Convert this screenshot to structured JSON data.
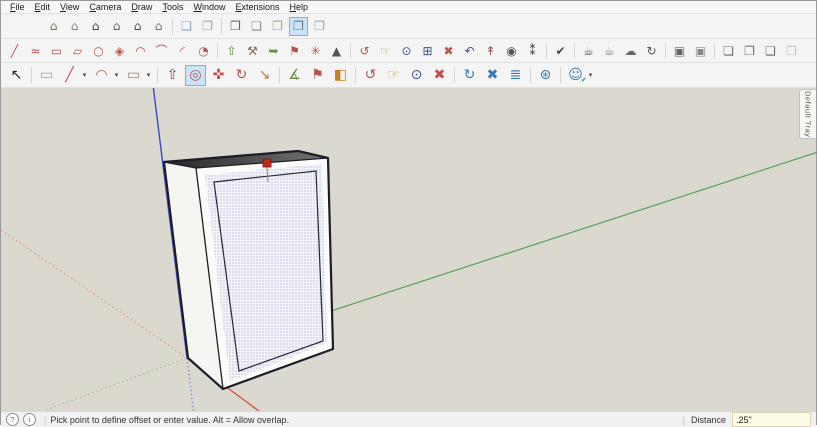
{
  "menu_bar": {
    "items": [
      "File",
      "Edit",
      "View",
      "Camera",
      "Draw",
      "Tools",
      "Window",
      "Extensions",
      "Help"
    ]
  },
  "toolbars": {
    "rows": [
      {
        "name": "toolbar-row1",
        "items": [
          {
            "name": "view-iso",
            "glyph": "⌂",
            "color": "#7d6a50"
          },
          {
            "name": "view-top",
            "glyph": "⌂",
            "color": "#8b7f6b"
          },
          {
            "name": "view-front",
            "glyph": "⌂",
            "color": "#3f3f3f"
          },
          {
            "name": "view-right",
            "glyph": "⌂",
            "color": "#6b5b49"
          },
          {
            "name": "view-back",
            "glyph": "⌂",
            "color": "#4a4a4a"
          },
          {
            "name": "view-left",
            "glyph": "⌂",
            "color": "#6e6e6e"
          },
          {
            "type": "separator"
          },
          {
            "name": "face-style-xray",
            "glyph": "❏",
            "color": "#7fa6c9"
          },
          {
            "name": "face-style-back-edges",
            "glyph": "❐",
            "color": "#9aa0a8"
          },
          {
            "type": "separator"
          },
          {
            "name": "face-style-wireframe",
            "glyph": "❒",
            "color": "#5b5b6b"
          },
          {
            "name": "face-style-hidden-line",
            "glyph": "❏",
            "color": "#8a8a8a"
          },
          {
            "name": "face-style-shaded",
            "glyph": "❐",
            "color": "#b09a72"
          },
          {
            "name": "face-style-shaded-textures",
            "glyph": "❒",
            "color": "#5a748f",
            "selected": true
          },
          {
            "name": "face-style-monochrome",
            "glyph": "❐",
            "color": "#8fa3b5"
          }
        ]
      },
      {
        "name": "toolbar-row2",
        "items": [
          {
            "name": "line-sketchy",
            "glyph": "╱",
            "color": "#b5534e"
          },
          {
            "name": "freehand-sketchy",
            "glyph": "≈",
            "color": "#b5534e"
          },
          {
            "name": "rectangle-sketchy",
            "glyph": "▭",
            "color": "#b5534e"
          },
          {
            "name": "rotated-rectangle-sketchy",
            "glyph": "▱",
            "color": "#b5534e"
          },
          {
            "name": "circle-sketchy",
            "glyph": "○",
            "color": "#b5534e"
          },
          {
            "name": "polygon-sketchy",
            "glyph": "◈",
            "color": "#b5534e"
          },
          {
            "name": "arc-sketchy",
            "glyph": "◠",
            "color": "#b5534e"
          },
          {
            "name": "two-point-arc-sketchy",
            "glyph": "⌒",
            "color": "#b5534e"
          },
          {
            "name": "three-point-arc-sketchy",
            "glyph": "◜",
            "color": "#b5534e"
          },
          {
            "name": "pie-sketchy",
            "glyph": "◔",
            "color": "#b5534e"
          },
          {
            "type": "separator"
          },
          {
            "name": "push-pull-sketchy",
            "glyph": "⇧",
            "color": "#6a8a3a"
          },
          {
            "name": "follow-me-sketchy",
            "glyph": "⚒",
            "color": "#7a6a5a"
          },
          {
            "name": "offset-sketchy",
            "glyph": "➥",
            "color": "#6a8a3a"
          },
          {
            "name": "text-sketchy",
            "glyph": "⚑",
            "color": "#b0524d"
          },
          {
            "name": "axes-tool",
            "glyph": "✳",
            "color": "#c0504d"
          },
          {
            "name": "cone-tool",
            "glyph": "▲",
            "color": "#555555"
          },
          {
            "type": "separator"
          },
          {
            "name": "orbit-small",
            "glyph": "↺",
            "color": "#b5534e"
          },
          {
            "name": "pan-small",
            "glyph": "☞",
            "color": "#c8a05a"
          },
          {
            "name": "zoom-small",
            "glyph": "⊙",
            "color": "#44508a"
          },
          {
            "name": "zoom-window",
            "glyph": "⊞",
            "color": "#44508a"
          },
          {
            "name": "zoom-extents-small",
            "glyph": "✖",
            "color": "#c0504d"
          },
          {
            "name": "zoom-previous",
            "glyph": "↶",
            "color": "#44508a"
          },
          {
            "name": "position-camera",
            "glyph": "↟",
            "color": "#8a5a5a"
          },
          {
            "name": "look-around",
            "glyph": "◉",
            "color": "#555555"
          },
          {
            "name": "walk",
            "glyph": "⁑",
            "color": "#333333"
          },
          {
            "type": "separator"
          },
          {
            "name": "model-checker",
            "glyph": "✔",
            "color": "#444444"
          },
          {
            "type": "separator"
          },
          {
            "name": "get-models-teapot",
            "glyph": "☕",
            "color": "#555555"
          },
          {
            "name": "share-model-teapot",
            "glyph": "☕",
            "color": "#888888"
          },
          {
            "name": "share-component-cloud",
            "glyph": "☁",
            "color": "#666666"
          },
          {
            "name": "trimble-connect-sync",
            "glyph": "↻",
            "color": "#555555"
          },
          {
            "type": "separator"
          },
          {
            "name": "match-photo",
            "glyph": "▣",
            "color": "#666666"
          },
          {
            "name": "photo-textures",
            "glyph": "▣",
            "color": "#8a8a8a"
          },
          {
            "type": "separator"
          },
          {
            "name": "styles-dialog",
            "glyph": "❏",
            "color": "#6a6a6a"
          },
          {
            "name": "scenes-dialog",
            "glyph": "❐",
            "color": "#6a6a6a"
          },
          {
            "name": "shadows-dialog",
            "glyph": "❑",
            "color": "#6a6a6a"
          },
          {
            "name": "watermark-dialog",
            "glyph": "❒",
            "color": "#6a6a6a",
            "disabled": true
          }
        ]
      },
      {
        "name": "toolbar-row3",
        "items": [
          {
            "name": "select-tool",
            "glyph": "↖",
            "color": "#1a1a1a"
          },
          {
            "type": "separator"
          },
          {
            "name": "eraser-tool",
            "glyph": "▭",
            "color": "#d08a96"
          },
          {
            "name": "line-tool",
            "glyph": "╱",
            "color": "#b5534e",
            "dropdown": true
          },
          {
            "name": "arc-tool",
            "glyph": "◠",
            "color": "#b5534e",
            "dropdown": true
          },
          {
            "name": "rectangle-tool",
            "glyph": "▭",
            "color": "#9a8a6a",
            "dropdown": true
          },
          {
            "type": "separator"
          },
          {
            "name": "push-pull-tool",
            "glyph": "⇧",
            "color": "#8a4a3a"
          },
          {
            "name": "offset-tool",
            "glyph": "◎",
            "color": "#c0504d",
            "selected": true
          },
          {
            "name": "move-tool",
            "glyph": "✜",
            "color": "#c0504d"
          },
          {
            "name": "rotate-tool",
            "glyph": "↻",
            "color": "#c0504d"
          },
          {
            "name": "scale-tool",
            "glyph": "↘",
            "color": "#b07a4a"
          },
          {
            "type": "separator"
          },
          {
            "name": "tape-measure-tool",
            "glyph": "∡",
            "color": "#6a8a4a"
          },
          {
            "name": "text-tool",
            "glyph": "⚑",
            "color": "#b5534e"
          },
          {
            "name": "paint-bucket-tool",
            "glyph": "◧",
            "color": "#c87d2a"
          },
          {
            "type": "separator"
          },
          {
            "name": "orbit-tool",
            "glyph": "↺",
            "color": "#b5534e"
          },
          {
            "name": "pan-tool",
            "glyph": "☞",
            "color": "#c8a05a"
          },
          {
            "name": "zoom-tool",
            "glyph": "⊙",
            "color": "#44508a"
          },
          {
            "name": "zoom-extents-tool",
            "glyph": "✖",
            "color": "#c0504d"
          },
          {
            "type": "separator"
          },
          {
            "name": "component-sync-ext",
            "glyph": "↻",
            "color": "#3a7ab5"
          },
          {
            "name": "flip-ext",
            "glyph": "✖",
            "color": "#3a7ab5"
          },
          {
            "name": "layer-stack-ext",
            "glyph": "≣",
            "color": "#3a7ab5"
          },
          {
            "type": "separator"
          },
          {
            "name": "intersect-ext",
            "glyph": "⊛",
            "color": "#3a7ab5"
          },
          {
            "type": "separator"
          },
          {
            "name": "sign-in",
            "glyph": "☺",
            "color": "#3a7ab5",
            "dropdown": true
          }
        ]
      }
    ]
  },
  "viewport": {
    "default_tray_label": "Default Tray",
    "axes": {
      "blue": "#3d49bb",
      "green": "#5ba05f",
      "red": "#d05c4e",
      "red_dotted": "#d98a80",
      "green_dotted": "#8fb892",
      "blue_dotted": "#7a82c9"
    },
    "colors": {
      "background": "#dbd8d0",
      "edge": "#1d1d28",
      "top_face_dark": "#262626",
      "top_face_light": "#757575",
      "left_face": "#f5f5f1",
      "front_face": "#fbfbf9",
      "stipple_bg": "#f4f5fa",
      "stipple_dot": "#7b82ba",
      "marker_red": "#c02a1e"
    }
  },
  "status_bar": {
    "help_icon": "?",
    "info_icon": "i",
    "divider": "|",
    "message": "Pick point to define offset or enter value. Alt = Allow overlap.",
    "distance_label": "Distance",
    "distance_value": ".25\""
  }
}
